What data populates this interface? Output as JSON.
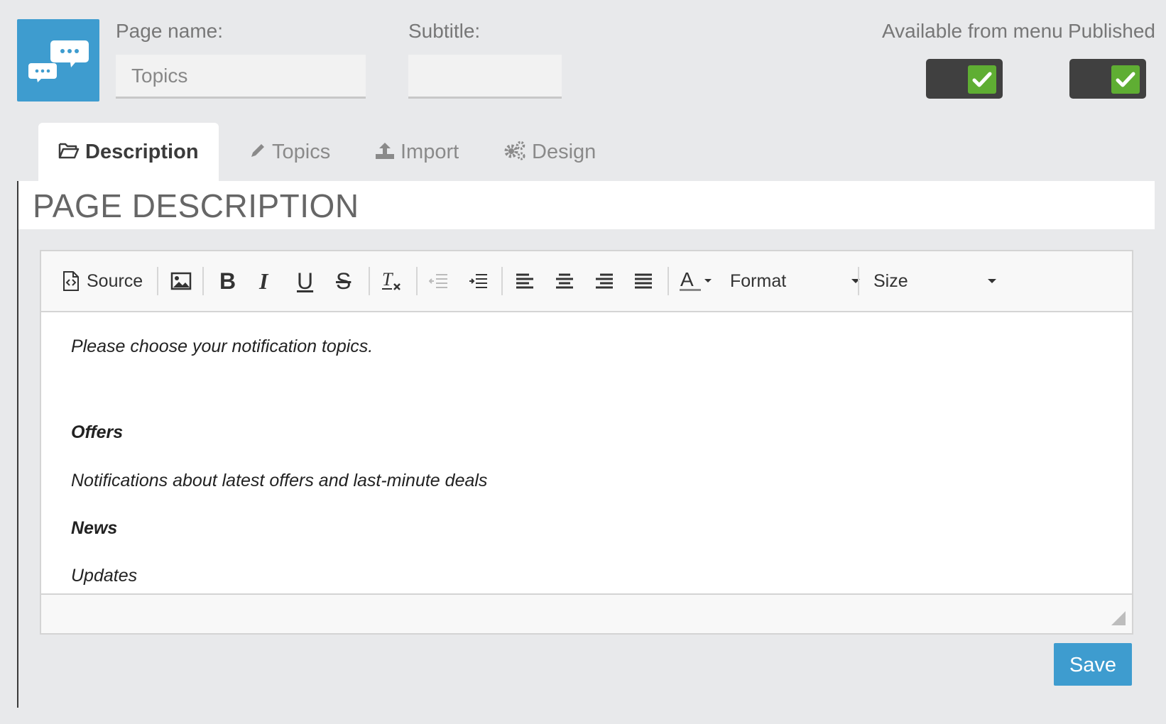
{
  "header": {
    "app_icon": "chat-bubbles-icon",
    "page_name_label": "Page name:",
    "page_name_value": "Topics",
    "subtitle_label": "Subtitle:",
    "subtitle_value": "",
    "available_label": "Available from menu",
    "available_checked": true,
    "published_label": "Published",
    "published_checked": true
  },
  "tabs": [
    {
      "label": "Description",
      "icon": "folder-open-icon",
      "active": true
    },
    {
      "label": "Topics",
      "icon": "pencil-icon",
      "active": false
    },
    {
      "label": "Import",
      "icon": "upload-icon",
      "active": false
    },
    {
      "label": "Design",
      "icon": "gears-icon",
      "active": false
    }
  ],
  "section": {
    "title": "PAGE DESCRIPTION"
  },
  "editor": {
    "toolbar": {
      "source_label": "Source",
      "format_label": "Format",
      "size_label": "Size"
    },
    "content": [
      {
        "text": "Please choose your notification topics.",
        "bold": false
      },
      {
        "text": "Offers",
        "bold": true
      },
      {
        "text": "Notifications about latest offers and last-minute deals",
        "bold": false
      },
      {
        "text": "News",
        "bold": true
      },
      {
        "text": "Updates",
        "bold": false
      }
    ]
  },
  "actions": {
    "save_label": "Save"
  },
  "colors": {
    "accent": "#3e9ccf",
    "toggle_bg": "#404040",
    "check_green": "#5fae33",
    "background": "#e8e9eb"
  }
}
